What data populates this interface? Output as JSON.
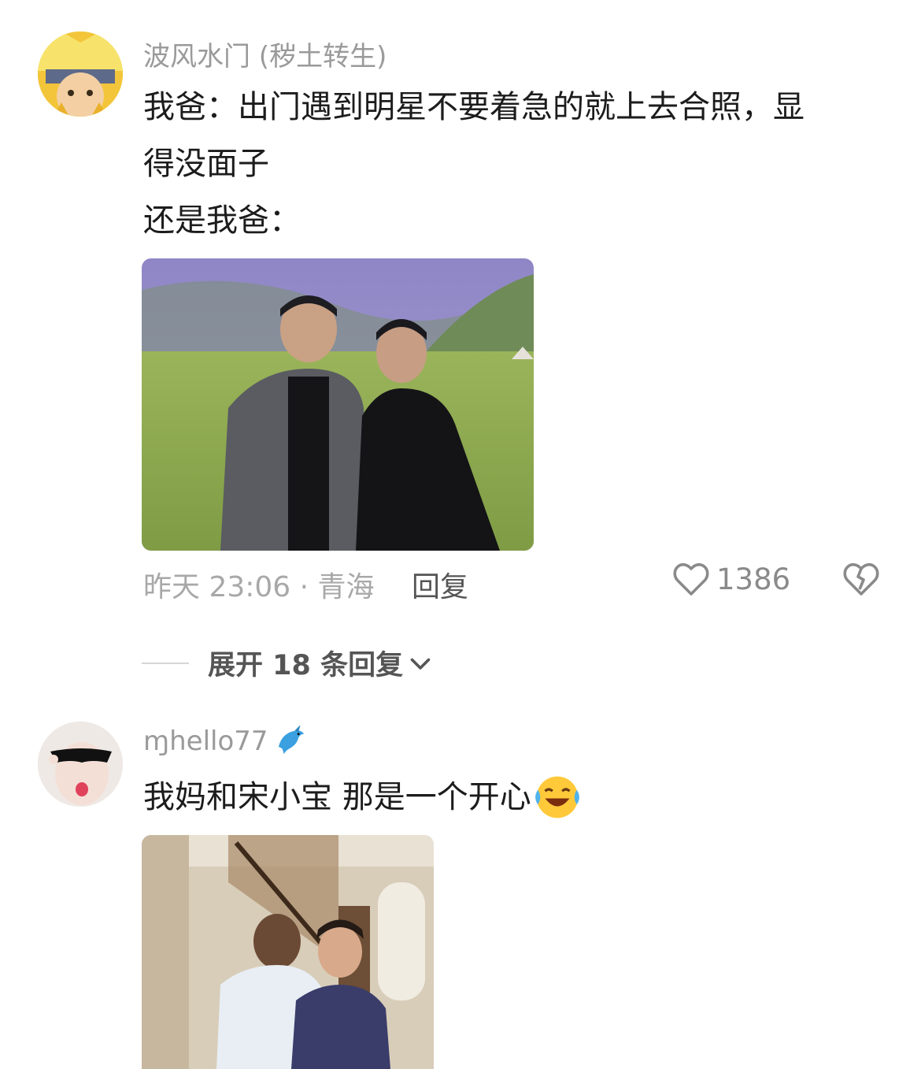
{
  "comments": [
    {
      "username": "波风水门 (秽土转生)",
      "text_lines": [
        "我爸：出门遇到明星不要着急的就上去合照，显",
        "得没面子",
        "还是我爸："
      ],
      "time_location": "昨天 23:06 · 青海",
      "reply_label": "回复",
      "likes": "1386",
      "expand_label": "展开 18 条回复"
    },
    {
      "username": "ɱhello77",
      "username_emoji": "dolphin-emoji",
      "text": "我妈和宋小宝 那是一个开心",
      "text_emoji": "laughing-crying-emoji"
    }
  ],
  "icons": [
    "heart-icon",
    "broken-heart-icon",
    "chevron-down-icon"
  ],
  "colors": {
    "meta_gray": "#a8a8a8",
    "text": "#1c1c1c",
    "username_gray": "#9a9a9a"
  }
}
